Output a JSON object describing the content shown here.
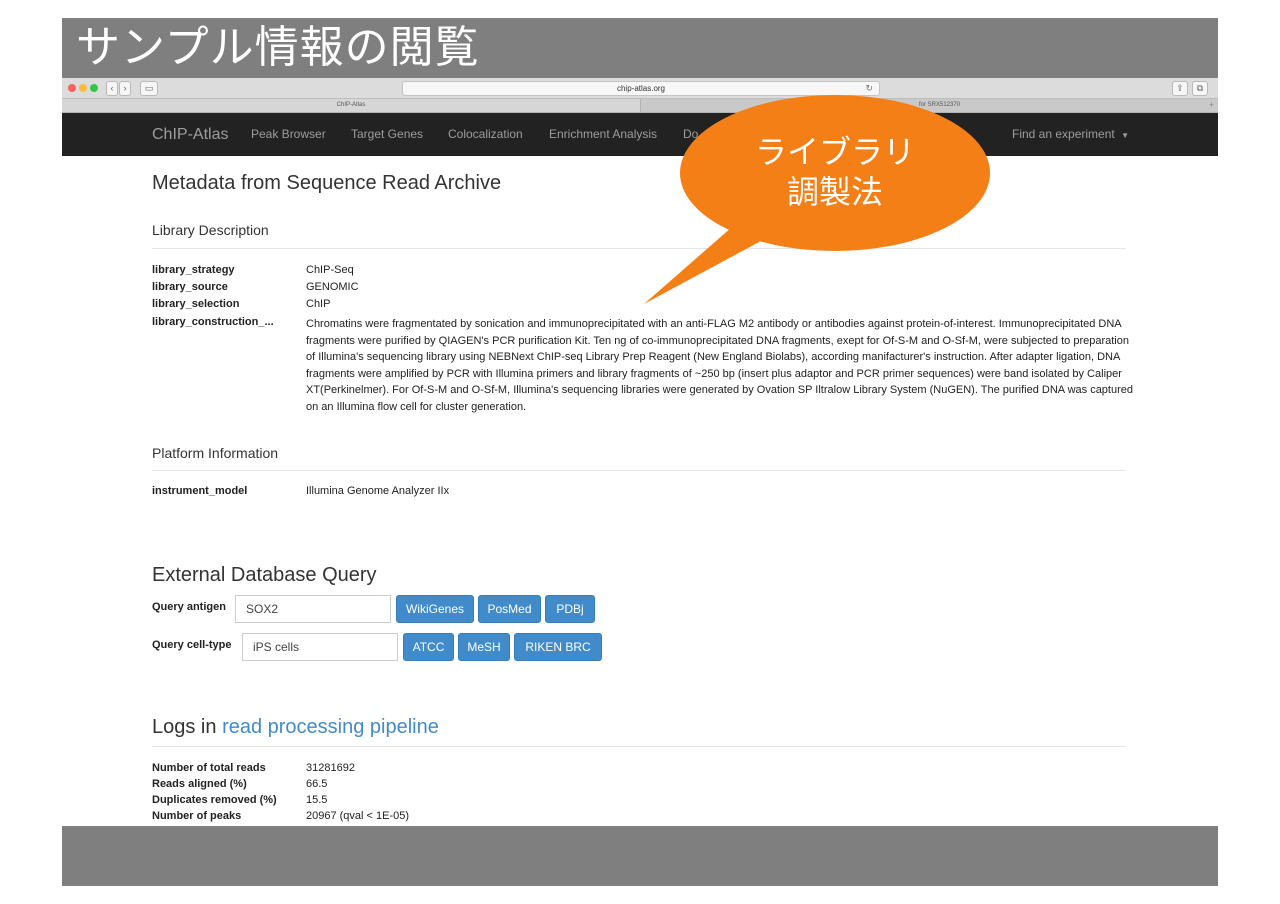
{
  "slide": {
    "title": "サンプル情報の閲覧",
    "background_color": "#7f7f7f"
  },
  "browser": {
    "url": "chip-atlas.org",
    "tabs": [
      {
        "label": "ChIP-Atlas"
      },
      {
        "label": "for SRX512370"
      }
    ],
    "icons": [
      "back-icon",
      "forward-icon",
      "sidebar-icon",
      "reload-icon",
      "share-icon",
      "tabs-icon",
      "new-tab-icon"
    ]
  },
  "navbar": {
    "brand": "ChIP-Atlas",
    "items": [
      {
        "label": "Peak Browser"
      },
      {
        "label": "Target Genes"
      },
      {
        "label": "Colocalization"
      },
      {
        "label": "Enrichment Analysis"
      },
      {
        "label": "Do"
      }
    ],
    "find_label": "Find an experiment",
    "background_color": "#222222"
  },
  "callout": {
    "line1": "ライブラリ",
    "line2": "調製法",
    "color": "#f57f17"
  },
  "metadata": {
    "title": "Metadata from Sequence Read Archive",
    "library": {
      "title": "Library Description",
      "rows": [
        {
          "key": "library_strategy",
          "value": "ChIP-Seq"
        },
        {
          "key": "library_source",
          "value": "GENOMIC"
        },
        {
          "key": "library_selection",
          "value": "ChIP"
        }
      ],
      "construction_key": "library_construction_...",
      "construction_text": "Chromatins were fragmentated by sonication and immunoprecipitated with an anti-FLAG M2 antibody or antibodies against protein-of-interest. Immunoprecipitated DNA fragments were purified by QIAGEN's PCR purification Kit. Ten ng of co-immunoprecipitated DNA fragments, exept for Of-S-M and O-Sf-M, were subjected to preparation of Illumina's sequencing library using NEBNext ChIP-seq Library Prep Reagent (New England Biolabs), according manifacturer's instruction. After adapter ligation, DNA fragments were amplified by PCR with Illumina primers and library fragments of ~250 bp (insert plus adaptor and PCR primer sequences) were band isolated by Caliper XT(Perkinelmer). For Of-S-M and O-Sf-M, Illumina's sequencing libraries were generated by Ovation SP Iltralow Library System (NuGEN). The purified DNA was captured on an Illumina flow cell for cluster generation."
    },
    "platform": {
      "title": "Platform Information",
      "key": "instrument_model",
      "value": "Illumina Genome Analyzer IIx"
    }
  },
  "external": {
    "title": "External Database Query",
    "antigen": {
      "label": "Query antigen",
      "value": "SOX2",
      "buttons": [
        "WikiGenes",
        "PosMed",
        "PDBj"
      ]
    },
    "celltype": {
      "label": "Query cell-type",
      "value": "iPS cells",
      "buttons": [
        "ATCC",
        "MeSH",
        "RIKEN BRC"
      ]
    },
    "button_color": "#428bca"
  },
  "logs": {
    "title_prefix": "Logs in",
    "title_link": "read processing pipeline",
    "rows": [
      {
        "key": "Number of total reads",
        "value": "31281692"
      },
      {
        "key": "Reads aligned (%)",
        "value": "66.5"
      },
      {
        "key": "Duplicates removed (%)",
        "value": "15.5"
      },
      {
        "key": "Number of peaks",
        "value": "20967 (qval < 1E-05)"
      }
    ]
  }
}
